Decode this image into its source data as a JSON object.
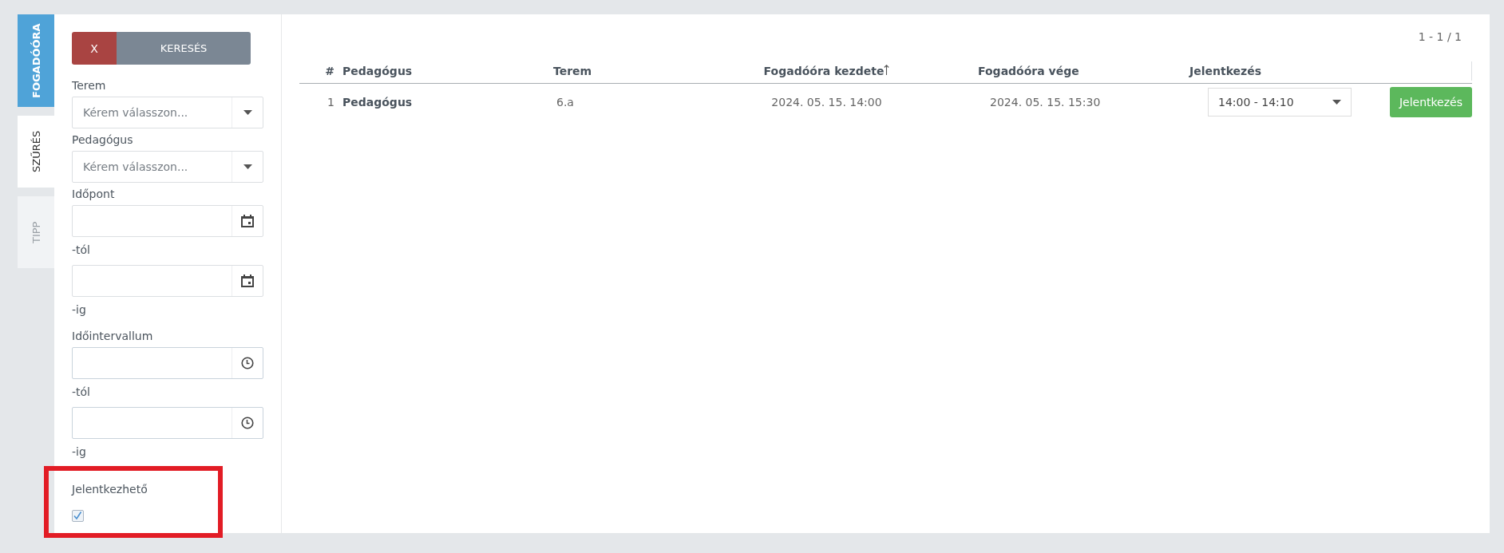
{
  "side_tabs": [
    {
      "label": "FOGADÓÓRA",
      "selected": true,
      "disabled": false
    },
    {
      "label": "SZŰRÉS",
      "selected": false,
      "disabled": false
    },
    {
      "label": "TIPP",
      "selected": false,
      "disabled": true
    }
  ],
  "filter": {
    "clear_button": "X",
    "search_button": "KERESÉS",
    "fields": [
      {
        "kind": "select",
        "label": "Terem",
        "placeholder": "Kérem válasszon..."
      },
      {
        "kind": "select",
        "label": "Pedagógus",
        "placeholder": "Kérem válasszon..."
      },
      {
        "kind": "date_range",
        "label": "Időpont",
        "from_label": "-tól",
        "to_label": "-ig"
      },
      {
        "kind": "time_range",
        "label": "Időintervallum",
        "from_label": "-tól",
        "to_label": "-ig"
      },
      {
        "kind": "checkbox",
        "label": "Jelentkezhető",
        "checked": true,
        "highlighted": true
      }
    ]
  },
  "table": {
    "pagination": "1 - 1 / 1",
    "columns": [
      {
        "label": "#",
        "sorted": false
      },
      {
        "label": "Pedagógus",
        "sorted": false
      },
      {
        "label": "Terem",
        "sorted": false
      },
      {
        "label": "Fogadóóra kezdete",
        "sorted": true
      },
      {
        "label": "Fogadóóra vége",
        "sorted": false
      },
      {
        "label": "Jelentkezés",
        "sorted": false
      }
    ],
    "rows": [
      {
        "index": "1",
        "teacher": "Pedagógus",
        "room": "6.a",
        "start": "2024. 05. 15. 14:00",
        "end": "2024. 05. 15. 15:30",
        "slot": "14:00 - 14:10",
        "button": "Jelentkezés"
      }
    ]
  }
}
